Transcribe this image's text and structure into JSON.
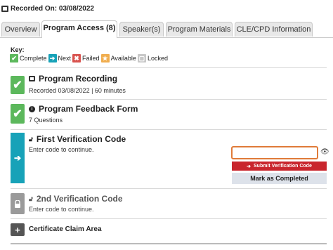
{
  "recorded_on": "Recorded On: 03/08/2022",
  "tabs": [
    {
      "label": "Overview"
    },
    {
      "label": "Program Access (8)"
    },
    {
      "label": "Speaker(s)"
    },
    {
      "label": "Program Materials"
    },
    {
      "label": "CLE/CPD Information"
    }
  ],
  "key": {
    "label": "Key:",
    "items": [
      {
        "label": "Complete",
        "color": "#5cb85c",
        "icon": "check-icon"
      },
      {
        "label": "Next",
        "color": "#17a2b8",
        "icon": "arrow-right-icon"
      },
      {
        "label": "Failed",
        "color": "#d9534f",
        "icon": "x-icon"
      },
      {
        "label": "Available",
        "color": "#f0ad4e",
        "icon": "star-icon"
      },
      {
        "label": "Locked",
        "color": "#c8c8c8",
        "icon": "lock-icon"
      }
    ]
  },
  "steps": {
    "recording": {
      "title": "Program Recording",
      "subtitle": "Recorded 03/08/2022  |  60 minutes",
      "status": "complete"
    },
    "feedback": {
      "title": "Program Feedback Form",
      "subtitle": "7 Questions",
      "status": "complete"
    },
    "verification1": {
      "title": "First Verification Code",
      "subtitle": "Enter code to continue.",
      "status": "next",
      "input_value": "",
      "submit_label": "Submit Verification Code",
      "mark_label": "Mark as Completed"
    },
    "verification2": {
      "title": "2nd Verification Code",
      "subtitle": "Enter code to continue.",
      "status": "locked"
    },
    "certificate": {
      "title": "Certificate Claim Area",
      "status": "expandable"
    }
  }
}
